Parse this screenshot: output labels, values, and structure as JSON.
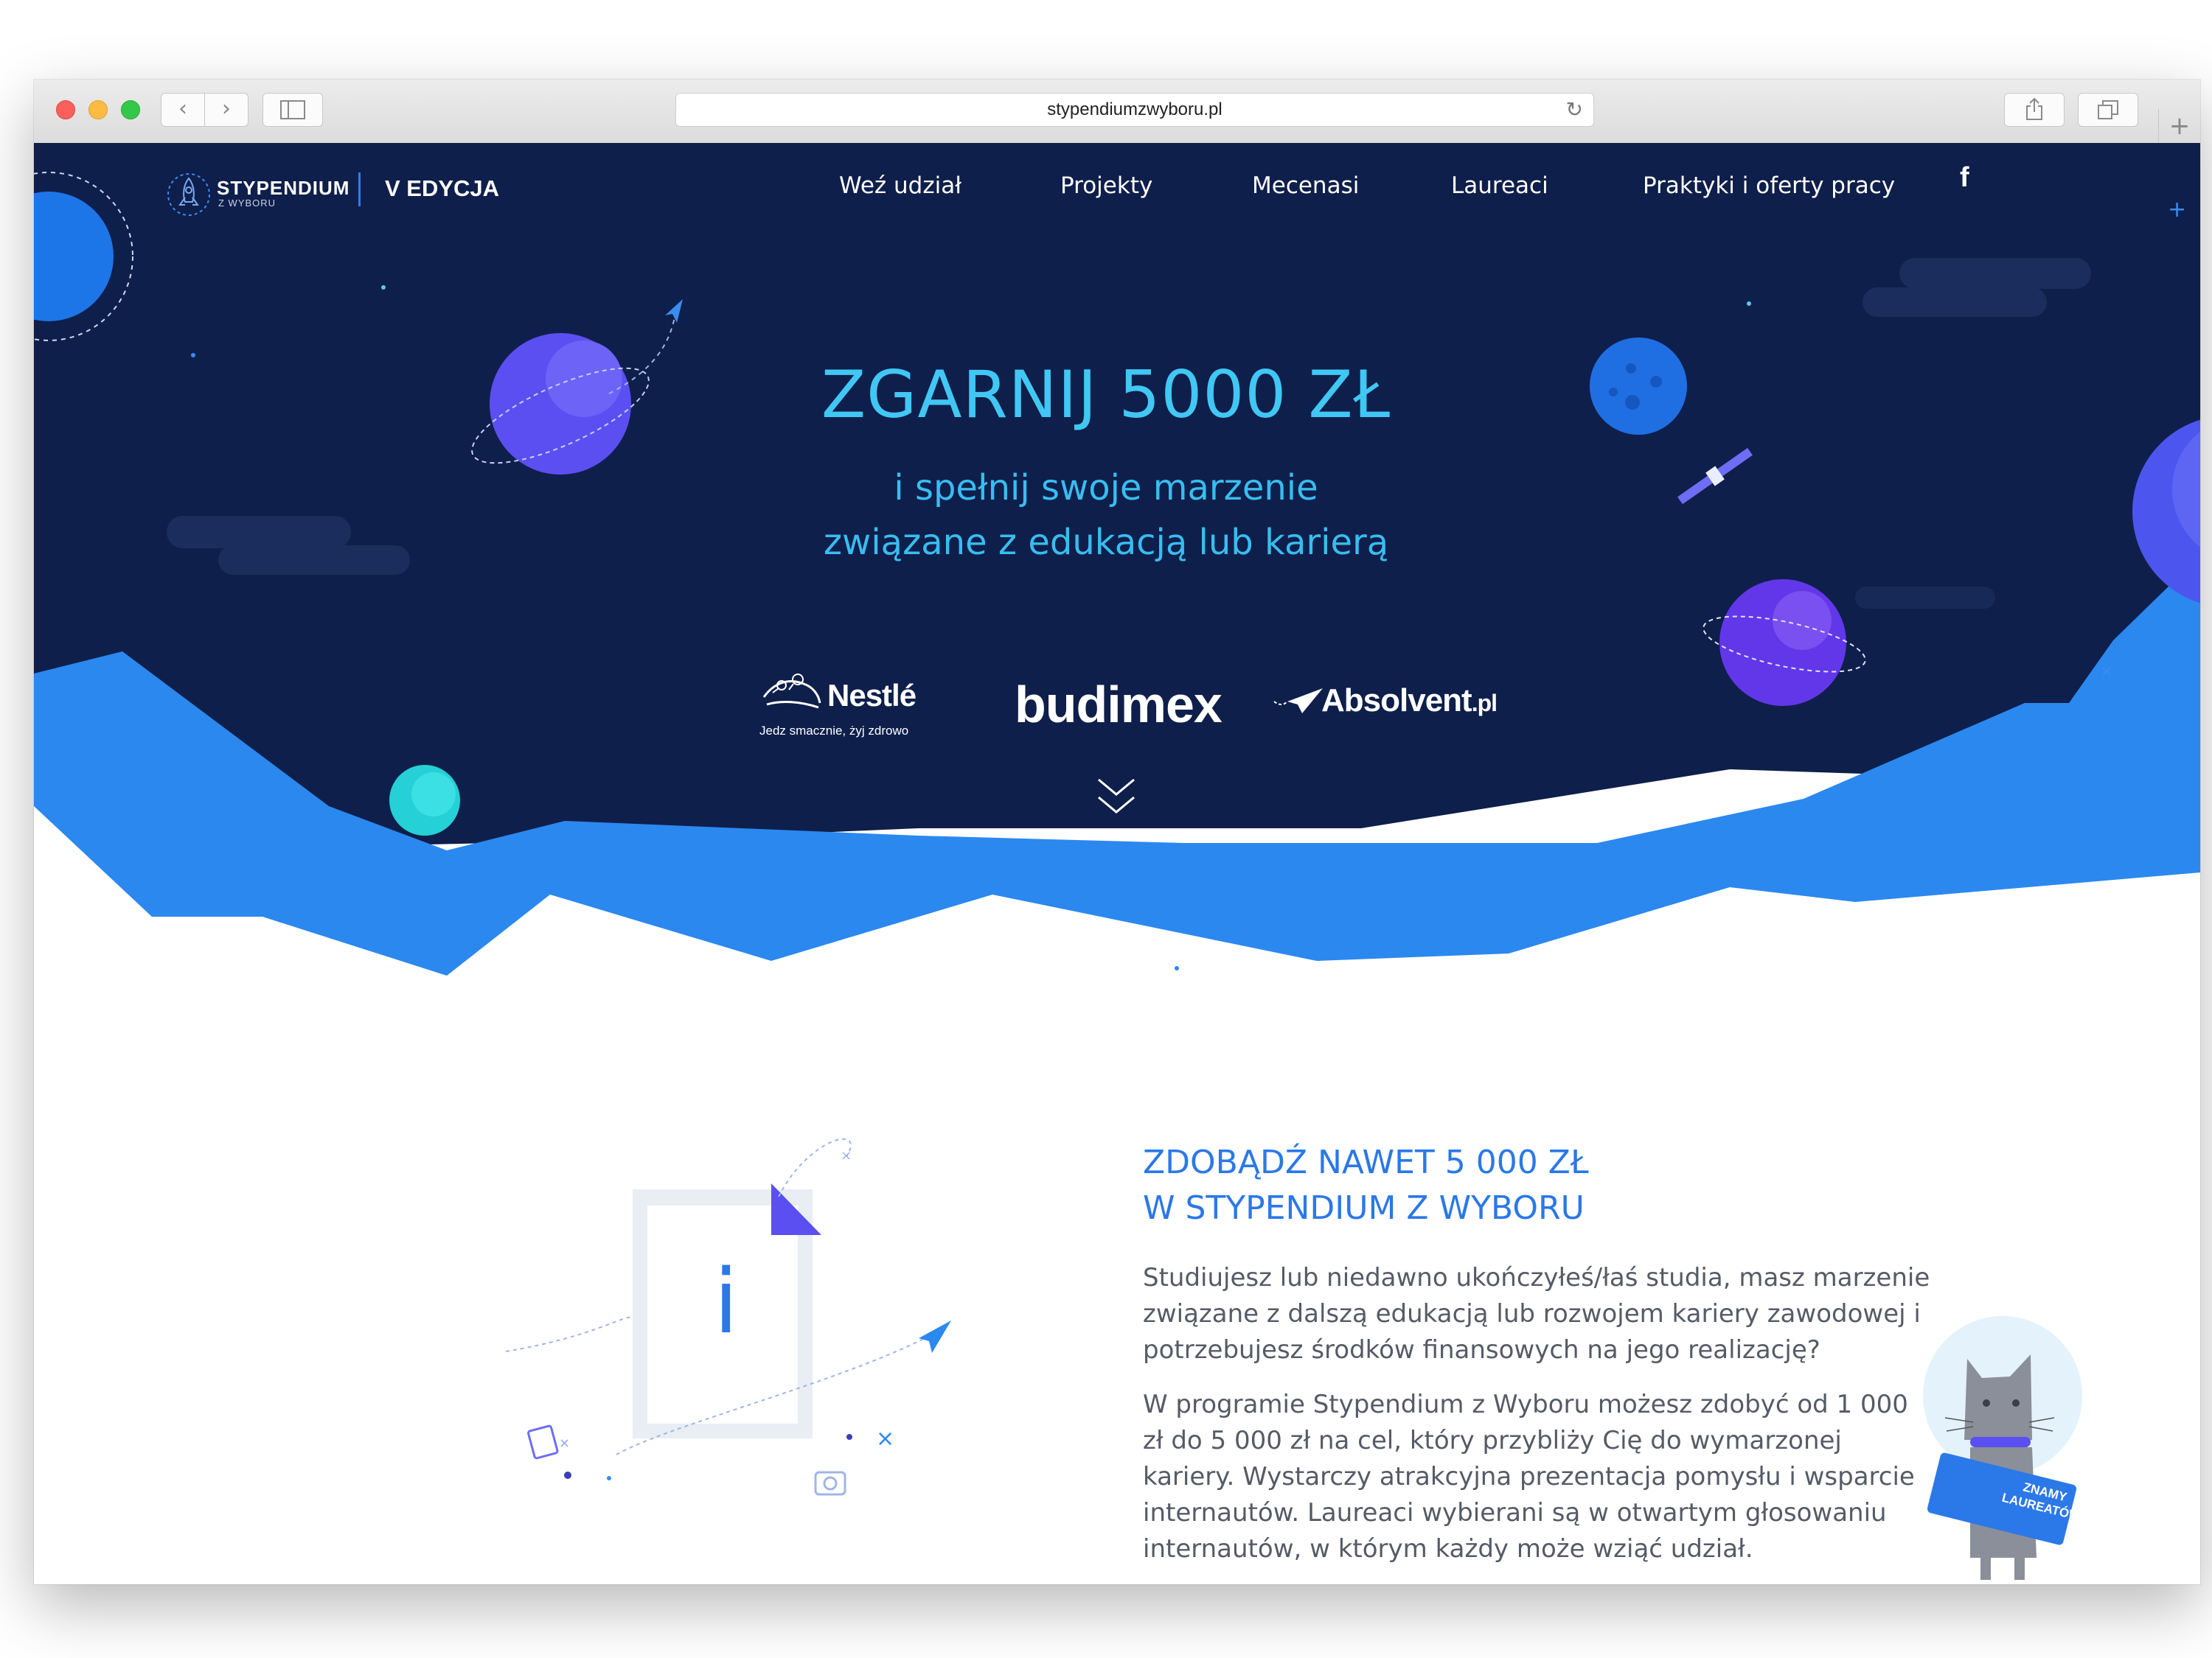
{
  "browser": {
    "url": "stypendiumzwyboru.pl"
  },
  "header": {
    "logo_main": "STYPENDIUM",
    "logo_sub": "Z WYBORU",
    "edition": "V EDYCJA",
    "nav": [
      "Weź udział",
      "Projekty",
      "Mecenasi",
      "Laureaci",
      "Praktyki i oferty pracy"
    ],
    "social": "f"
  },
  "hero": {
    "headline": "ZGARNIJ 5000 ZŁ",
    "subline1": "i spełnij swoje marzenie",
    "subline2": "związane z edukacją lub karierą",
    "sponsors": {
      "nestle": "Nestlé",
      "nestle_tagline": "Jedz smacznie, żyj zdrowo",
      "budimex": "budimex",
      "absolvent": "Absolvent",
      "absolvent_suffix": ".pl"
    }
  },
  "info": {
    "title_line1": "ZDOBĄDŹ NAWET 5 000 ZŁ",
    "title_line2": "W STYPENDIUM Z WYBORU",
    "paragraph1": "Studiujesz lub niedawno ukończyłeś/łaś studia, masz marzenie związane z dalszą edukacją lub rozwojem kariery zawodowej i potrzebujesz środków finansowych na jego realizację?",
    "paragraph2": "W programie Stypendium z Wyboru możesz zdobyć od 1 000 zł do 5 000 zł na cel, który przybliży Cię do wymarzonej kariery. Wystarczy atrakcyjna prezentacja pomysłu i wsparcie internautów. Laureaci wybierani są w otwartym głosowaniu internautów, w którym każdy może wziąć udział.",
    "doc_icon_letter": "i"
  },
  "mascot": {
    "sign_line1": "ZNAMY",
    "sign_line2": "LAUREATÓW"
  },
  "colors": {
    "space": "#0f1f4b",
    "wave": "#2b88ef",
    "accent": "#2b78e8",
    "headline": "#41c7f3"
  }
}
